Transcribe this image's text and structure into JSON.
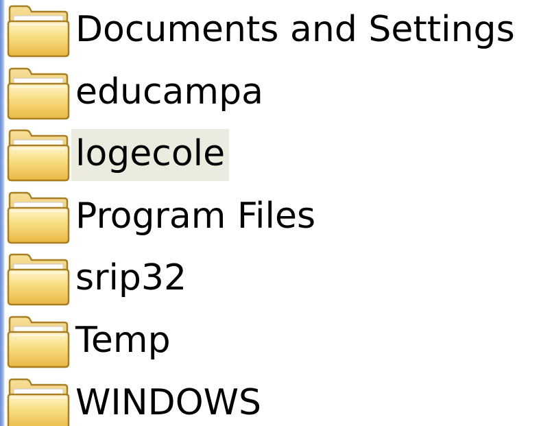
{
  "folders": [
    {
      "name": "Documents and Settings",
      "icon": "folder-icon",
      "selected": false
    },
    {
      "name": "educampa",
      "icon": "folder-icon",
      "selected": false
    },
    {
      "name": "logecole",
      "icon": "folder-icon",
      "selected": true
    },
    {
      "name": "Program Files",
      "icon": "folder-icon",
      "selected": false
    },
    {
      "name": "srip32",
      "icon": "folder-icon",
      "selected": false
    },
    {
      "name": "Temp",
      "icon": "folder-icon",
      "selected": false
    },
    {
      "name": "WINDOWS",
      "icon": "folder-icon",
      "selected": false
    }
  ],
  "colors": {
    "selection_background": "#ecebe0",
    "left_edge": "#6b8fd6",
    "folder_body": "#f4d678",
    "folder_outline": "#b8902c"
  }
}
